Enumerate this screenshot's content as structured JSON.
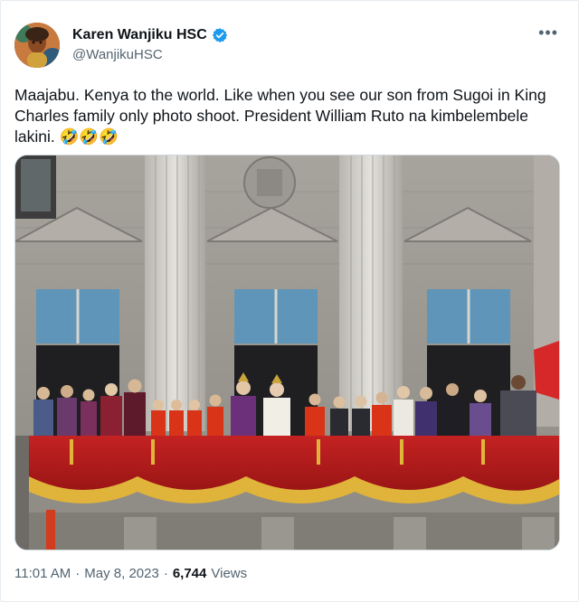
{
  "user": {
    "display_name": "Karen Wanjiku HSC",
    "handle": "@WanjikuHSC",
    "verified_color": "#1d9bf0"
  },
  "more_icon": "more-horizontal-icon",
  "tweet": {
    "text": "Maajabu. Kenya to the world. Like when you see our son from Sugoi in King Charles family only photo shoot. President William Ruto na kimbelembele lakini.",
    "emojis": "🤣🤣🤣"
  },
  "meta": {
    "time": "11:01 AM",
    "separator": "·",
    "date": "May 8, 2023",
    "separator2": "·",
    "views_count": "6,744",
    "views_label": "Views"
  },
  "colors": {
    "text_primary": "#0f1419",
    "text_secondary": "#536471",
    "border": "#cfd9de",
    "balcony_red": "#b01c1c",
    "fringe_gold": "#e0b43a"
  }
}
